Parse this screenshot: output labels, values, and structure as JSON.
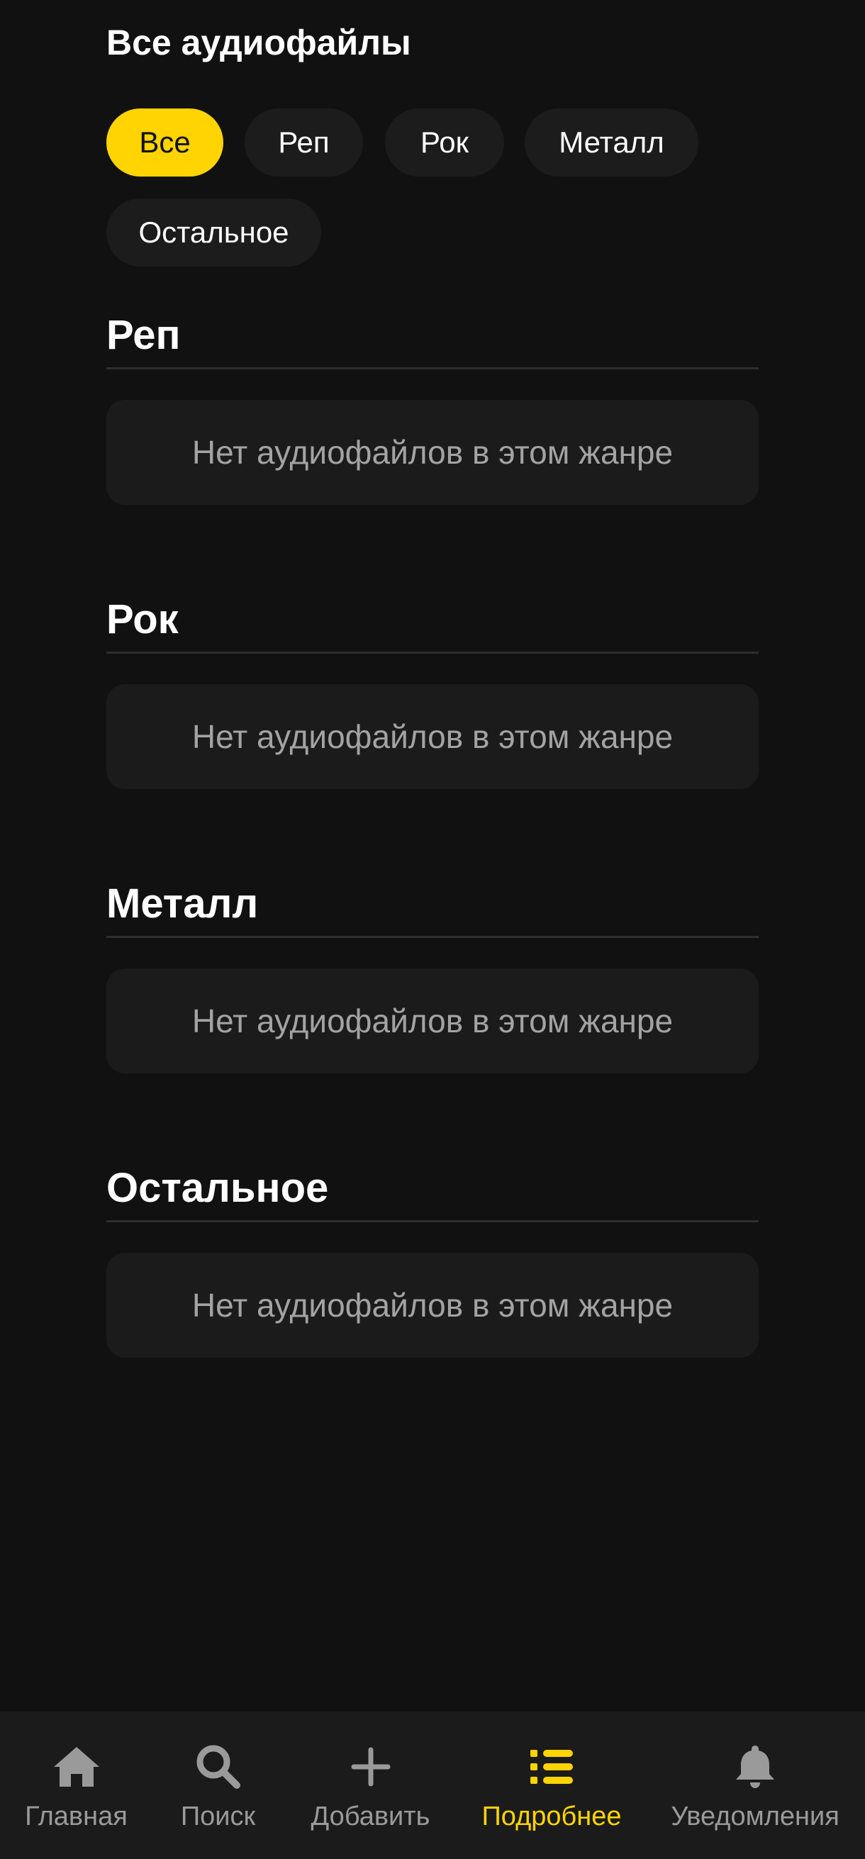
{
  "header": {
    "title": "Все аудиофайлы"
  },
  "filters": [
    {
      "label": "Все",
      "active": true
    },
    {
      "label": "Реп",
      "active": false
    },
    {
      "label": "Рок",
      "active": false
    },
    {
      "label": "Металл",
      "active": false
    },
    {
      "label": "Остальное",
      "active": false
    }
  ],
  "sections": [
    {
      "title": "Реп",
      "empty_text": "Нет аудиофайлов в этом жанре"
    },
    {
      "title": "Рок",
      "empty_text": "Нет аудиофайлов в этом жанре"
    },
    {
      "title": "Металл",
      "empty_text": "Нет аудиофайлов в этом жанре"
    },
    {
      "title": "Остальное",
      "empty_text": "Нет аудиофайлов в этом жанре"
    }
  ],
  "bottom_nav": [
    {
      "label": "Главная",
      "icon": "home-icon",
      "active": false
    },
    {
      "label": "Поиск",
      "icon": "search-icon",
      "active": false
    },
    {
      "label": "Добавить",
      "icon": "plus-icon",
      "active": false
    },
    {
      "label": "Подробнее",
      "icon": "list-icon",
      "active": true
    },
    {
      "label": "Уведомления",
      "icon": "bell-icon",
      "active": false
    }
  ],
  "colors": {
    "accent": "#ffd400",
    "background": "#111111",
    "card": "#1b1b1b",
    "muted_text": "#a3a3a3"
  }
}
